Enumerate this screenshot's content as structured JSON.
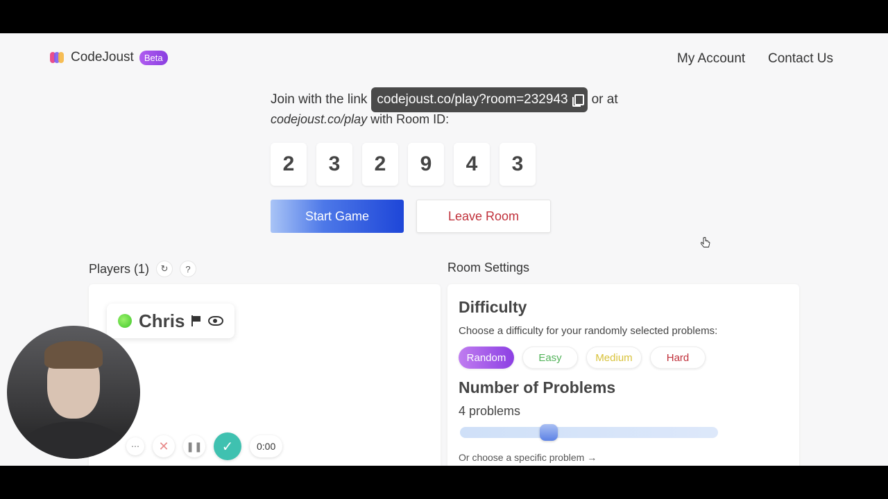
{
  "header": {
    "logo_text": "CodeJoust",
    "beta_badge": "Beta",
    "nav": {
      "my_account": "My Account",
      "contact_us": "Contact Us"
    }
  },
  "join": {
    "prefix": "Join with the link",
    "link": "codejoust.co/play?room=232943",
    "suffix": "or at",
    "alt_url": "codejoust.co/play",
    "alt_suffix": "with Room ID:"
  },
  "room_id_digits": [
    "2",
    "3",
    "2",
    "9",
    "4",
    "3"
  ],
  "actions": {
    "start_game": "Start Game",
    "leave_room": "Leave Room"
  },
  "players": {
    "title": "Players (1)",
    "list": [
      {
        "name": "Chris",
        "status_color": "#3fc62a"
      }
    ]
  },
  "settings": {
    "title": "Room Settings",
    "difficulty": {
      "title": "Difficulty",
      "description": "Choose a difficulty for your randomly selected problems:",
      "options": [
        "Random",
        "Easy",
        "Medium",
        "Hard"
      ],
      "selected": "Random"
    },
    "num_problems": {
      "title": "Number of Problems",
      "value_label": "4 problems",
      "value": 4
    },
    "choose_specific": "Or choose a specific problem →"
  },
  "recorder": {
    "timer": "0:00"
  },
  "colors": {
    "accent_blue": "#1e46d8",
    "danger_red": "#c0303a",
    "beta_purple": "#8a3fe0",
    "done_teal": "#3fc1b0"
  }
}
